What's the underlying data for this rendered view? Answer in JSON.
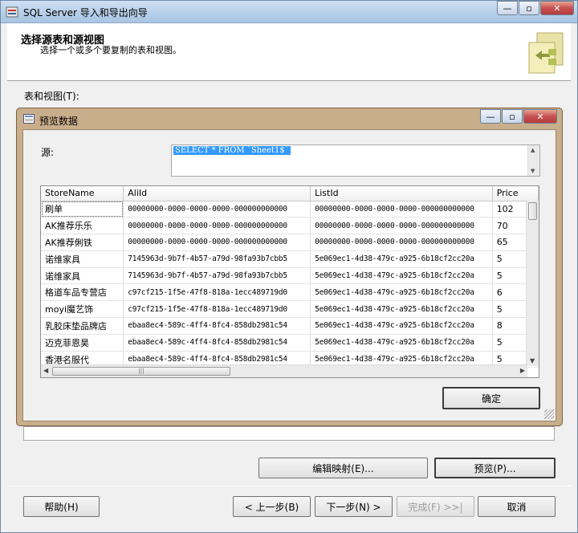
{
  "window": {
    "title": "SQL Server 导入和导出向导"
  },
  "header": {
    "title": "选择源表和源视图",
    "subtitle": "选择一个或多个要复制的表和视图。"
  },
  "tables_label": "表和视图(T):",
  "preview": {
    "title": "预览数据",
    "source_label": "源:",
    "sql": "SELECT * FROM `Sheet1$`",
    "columns": [
      "StoreName",
      "AliId",
      "ListId",
      "Price"
    ],
    "rows": [
      [
        "刷单",
        "00000000-0000-0000-0000-000000000000",
        "00000000-0000-0000-0000-000000000000",
        "102"
      ],
      [
        "AK推荐乐乐",
        "00000000-0000-0000-0000-000000000000",
        "00000000-0000-0000-0000-000000000000",
        "70"
      ],
      [
        "AK推荐俐铁",
        "00000000-0000-0000-0000-000000000000",
        "00000000-0000-0000-0000-000000000000",
        "65"
      ],
      [
        "诺维家具",
        "7145963d-9b7f-4b57-a79d-98fa93b7cbb5",
        "5e069ec1-4d38-479c-a925-6b18cf2cc20a",
        "5"
      ],
      [
        "诺维家具",
        "7145963d-9b7f-4b57-a79d-98fa93b7cbb5",
        "5e069ec1-4d38-479c-a925-6b18cf2cc20a",
        "5"
      ],
      [
        "格道车品专营店",
        "c97cf215-1f5e-47f8-818a-1ecc489719d0",
        "5e069ec1-4d38-479c-a925-6b18cf2cc20a",
        "6"
      ],
      [
        "moyi魔艺饰",
        "c97cf215-1f5e-47f8-818a-1ecc489719d0",
        "5e069ec1-4d38-479c-a925-6b18cf2cc20a",
        "5"
      ],
      [
        "乳胶床垫品牌店",
        "ebaa8ec4-589c-4ff4-8fc4-858db2981c54",
        "5e069ec1-4d38-479c-a925-6b18cf2cc20a",
        "8"
      ],
      [
        "迈克菲恩昊",
        "ebaa8ec4-589c-4ff4-8fc4-858db2981c54",
        "5e069ec1-4d38-479c-a925-6b18cf2cc20a",
        "5"
      ],
      [
        "香港名服代",
        "ebaa8ec4-589c-4ff4-8fc4-858db2981c54",
        "5e069ec1-4d38-479c-a925-6b18cf2cc20a",
        "5"
      ]
    ],
    "ok_label": "确定"
  },
  "buttons": {
    "edit_mappings": "编辑映射(E)...",
    "preview": "预览(P)...",
    "help": "帮助(H)",
    "back": "< 上一步(B)",
    "next": "下一步(N) >",
    "finish": "完成(F) >>|",
    "cancel": "取消"
  },
  "icons": {
    "app": "sql-server-icon",
    "logo": "wizard-logo-icon",
    "preview": "preview-icon"
  }
}
